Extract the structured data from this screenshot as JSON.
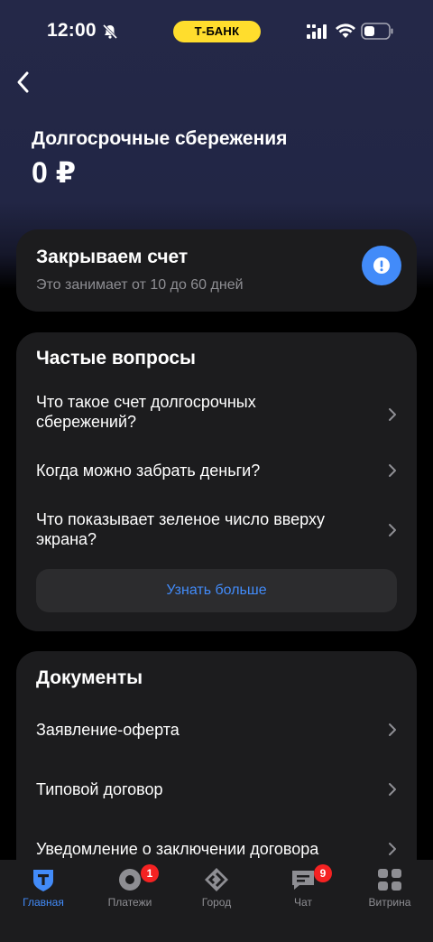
{
  "status_bar": {
    "time": "12:00",
    "carrier_pill": "Т-БАНК"
  },
  "header": {
    "title": "Долгосрочные сбережения",
    "balance": "0 ₽"
  },
  "status_card": {
    "title": "Закрываем счет",
    "subtitle": "Это занимает от 10 до 60 дней",
    "icon": "exclamation-icon",
    "accent": "#428bf9"
  },
  "faq": {
    "heading": "Частые вопросы",
    "items": [
      {
        "line1": "Что такое счет долгосрочных",
        "line2": "сбережений?"
      },
      {
        "line1": "Когда можно забрать деньги?",
        "line2": ""
      },
      {
        "line1": "Что показывает зеленое число вверху",
        "line2": "экрана?"
      }
    ],
    "more_label": "Узнать больше"
  },
  "documents": {
    "heading": "Документы",
    "items": [
      {
        "label": "Заявление-оферта"
      },
      {
        "label": "Типовой договор"
      },
      {
        "label": "Уведомление о заключении договора"
      }
    ]
  },
  "tab_bar": {
    "tabs": [
      {
        "label": "Главная",
        "icon": "t-shield-icon",
        "active": true
      },
      {
        "label": "Платежи",
        "icon": "payments-icon",
        "badge": "1"
      },
      {
        "label": "Город",
        "icon": "city-icon"
      },
      {
        "label": "Чат",
        "icon": "chat-icon",
        "badge": "9"
      },
      {
        "label": "Витрина",
        "icon": "showcase-icon"
      }
    ]
  },
  "colors": {
    "accent": "#428bf9",
    "card": "#1c1c1e",
    "hero": "#242848",
    "badge": "#f52222",
    "brand": "#ffdd2d"
  }
}
